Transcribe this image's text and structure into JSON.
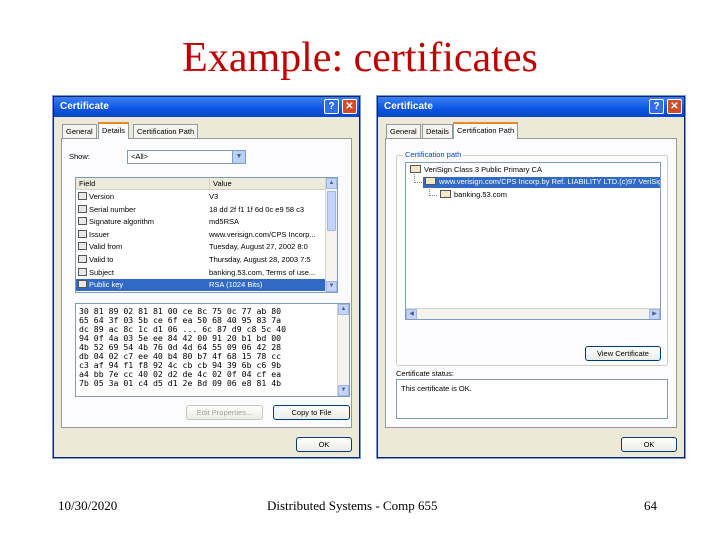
{
  "slide": {
    "title": "Example: certificates",
    "footer_date": "10/30/2020",
    "footer_center": "Distributed Systems - Comp 655",
    "footer_page": "64"
  },
  "dialog_left": {
    "title": "Certificate",
    "tabs": [
      "General",
      "Details",
      "Certification Path"
    ],
    "active_tab": "Details",
    "show_label": "Show:",
    "show_value": "<All>",
    "columns": [
      "Field",
      "Value"
    ],
    "rows": [
      {
        "field": "Version",
        "value": "V3"
      },
      {
        "field": "Serial number",
        "value": "18 dd 2f f1 1f 6d 0c e9 58 c3"
      },
      {
        "field": "Signature algorithm",
        "value": "md5RSA"
      },
      {
        "field": "Issuer",
        "value": "www.verisign.com/CPS Incorp..."
      },
      {
        "field": "Valid from",
        "value": "Tuesday, August 27, 2002 8:0"
      },
      {
        "field": "Valid to",
        "value": "Thursday, August 28, 2003 7:5"
      },
      {
        "field": "Subject",
        "value": "banking.53.com, Terms of use..."
      },
      {
        "field": "Public key",
        "value": "RSA (1024 Bits)"
      }
    ],
    "selected_row": 7,
    "hex_lines": [
      "30 81 89 02 81 81 00 ce 8c 75 0c 77 ab 80",
      "65 64 3f 03 5b ce 6f ea 50 68 40 95 83 7a",
      "dc 89 ac 8c 1c d1 06 ... 6c 87 d9 c8 5c 40",
      "94 0f 4a 03 5e ee 84 42 00 91 20 b1 bd 00",
      "4b 52 69 54 4b 76 0d 4d 64 55 09 06 42 28",
      "db 04 02 c7 ee 40 b4 80 b7 4f 68 15 78 cc",
      "c3 af 94 f1 f8 92 4c cb cb 94 39 6b c6 9b",
      "a4 bb 7e cc 40 02 d2 de 4c 02 0f 04 cf ea",
      "7b 05 3a 01 c4 d5 d1 2e 8d 09 06 e8 81 4b"
    ],
    "edit_button": "Edit Properties...",
    "copy_button": "Copy to File",
    "ok_button": "OK"
  },
  "dialog_right": {
    "title": "Certificate",
    "tabs": [
      "General",
      "Details",
      "Certification Path"
    ],
    "active_tab": "Certification Path",
    "path_label": "Certification path",
    "path_nodes": [
      "VeriSign Class 3 Public Primary CA",
      "www.verisign.com/CPS Incorp.by Ref. LIABILITY LTD.(c)97 VeriSign",
      "banking.53.com"
    ],
    "view_button": "View Certificate",
    "status_label": "Certificate status:",
    "status_text": "This certificate is OK.",
    "ok_button": "OK"
  }
}
